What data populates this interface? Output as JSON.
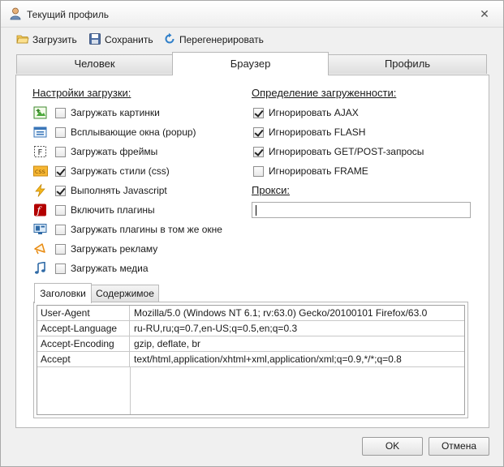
{
  "window": {
    "title": "Текущий профиль",
    "close_glyph": "✕"
  },
  "toolbar": {
    "load_label": "Загрузить",
    "save_label": "Сохранить",
    "regen_label": "Перегенерировать"
  },
  "tabs": [
    {
      "label": "Человек",
      "active": false
    },
    {
      "label": "Браузер",
      "active": true
    },
    {
      "label": "Профиль",
      "active": false
    }
  ],
  "load_settings": {
    "title": "Настройки загрузки:",
    "items": [
      {
        "label": "Загружать картинки",
        "checked": false,
        "icon": "image-icon"
      },
      {
        "label": "Всплывающие окна (popup)",
        "checked": false,
        "icon": "popup-window-icon"
      },
      {
        "label": "Загружать фреймы",
        "checked": false,
        "icon": "frame-icon"
      },
      {
        "label": "Загружать стили (css)",
        "checked": true,
        "icon": "css-icon"
      },
      {
        "label": "Выполнять Javascript",
        "checked": true,
        "icon": "javascript-bolt-icon"
      },
      {
        "label": "Включить плагины",
        "checked": false,
        "icon": "flash-plugin-icon"
      },
      {
        "label": "Загружать плагины в том же окне",
        "checked": false,
        "icon": "monitor-plugin-icon"
      },
      {
        "label": "Загружать рекламу",
        "checked": false,
        "icon": "megaphone-icon"
      },
      {
        "label": "Загружать медиа",
        "checked": false,
        "icon": "music-note-icon"
      }
    ]
  },
  "load_detection": {
    "title": "Определение загруженности:",
    "items": [
      {
        "label": "Игнорировать AJAX",
        "checked": true
      },
      {
        "label": "Игнорировать FLASH",
        "checked": true
      },
      {
        "label": "Игнорировать GET/POST-запросы",
        "checked": true
      },
      {
        "label": "Игнорировать FRAME",
        "checked": false
      }
    ]
  },
  "proxy": {
    "title": "Прокси:",
    "value": ""
  },
  "subtabs": [
    {
      "label": "Заголовки",
      "active": true
    },
    {
      "label": "Содержимое",
      "active": false
    }
  ],
  "headers": [
    {
      "name": "User-Agent",
      "value": "Mozilla/5.0 (Windows NT 6.1; rv:63.0) Gecko/20100101 Firefox/63.0"
    },
    {
      "name": "Accept-Language",
      "value": "ru-RU,ru;q=0.7,en-US;q=0.5,en;q=0.3"
    },
    {
      "name": "Accept-Encoding",
      "value": "gzip, deflate, br"
    },
    {
      "name": "Accept",
      "value": "text/html,application/xhtml+xml,application/xml;q=0.9,*/*;q=0.8"
    }
  ],
  "footer": {
    "ok_label": "OK",
    "cancel_label": "Отмена"
  }
}
